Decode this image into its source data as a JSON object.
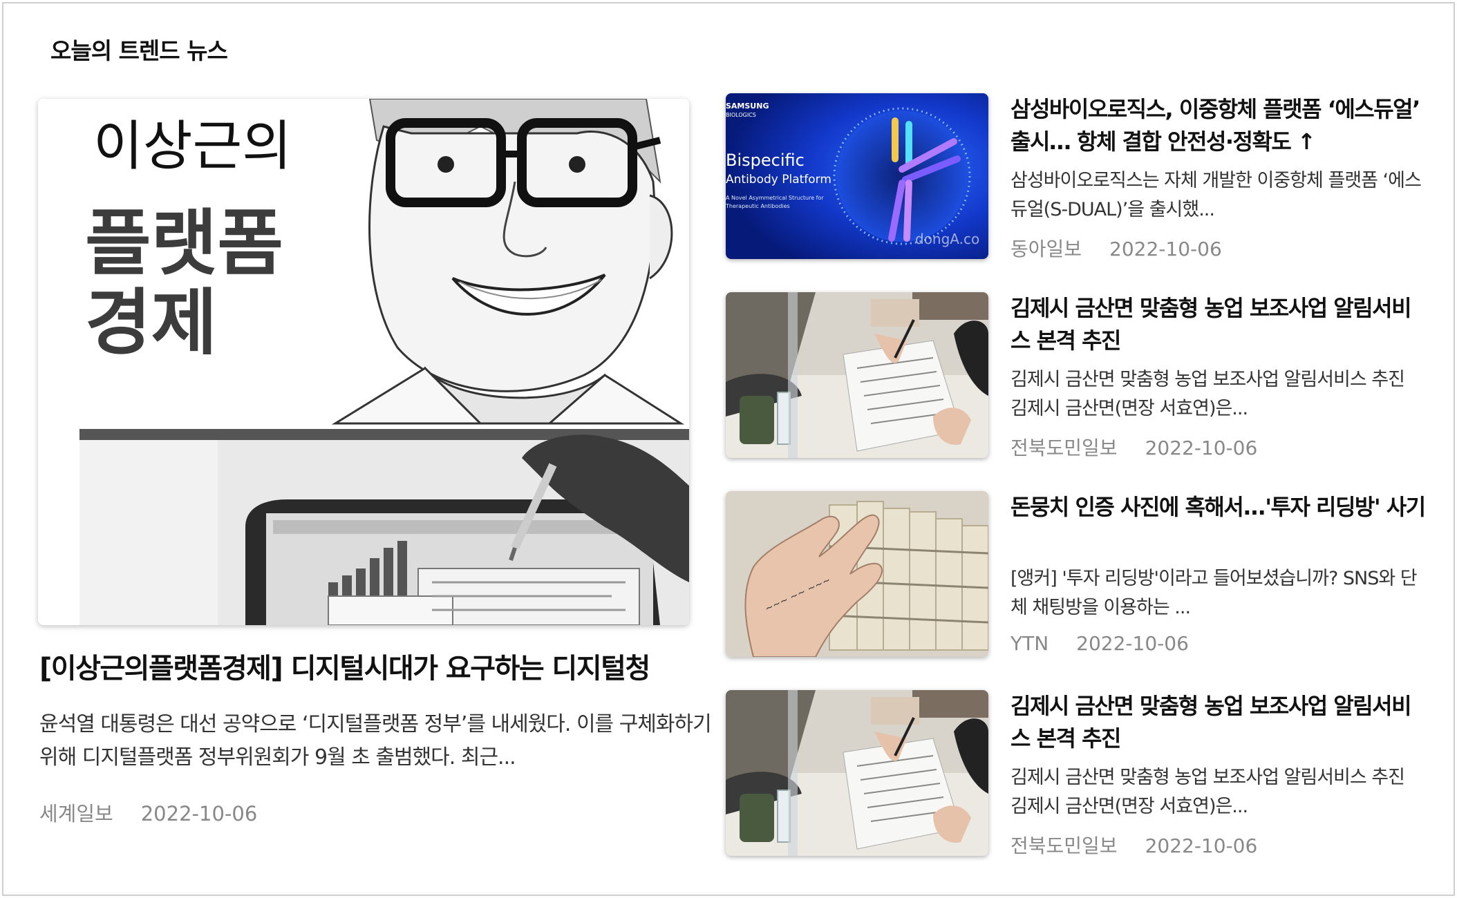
{
  "section": {
    "title": "오늘의 트렌드 뉴스"
  },
  "main_article": {
    "image_alt": "이상근의 플랫폼경제 칼럼 일러스트",
    "image_text_line1": "이상근의",
    "image_text_line2": "플랫폼",
    "image_text_line3": "경제",
    "headline": "[이상근의플랫폼경제] 디지털시대가 요구하는 디지털청",
    "summary": "윤석열 대통령은 대선 공약으로 ‘디지털플랫폼 정부’를 내세웠다. 이를 구체화하기 위해 디지털플랫폼 정부위원회가 9월 초 출범했다. 최근...",
    "source": "세계일보",
    "date": "2022-10-06"
  },
  "side_articles": [
    {
      "headline": "삼성바이오로직스, 이중항체 플랫폼 ‘에스듀얼’ 출시… 항체 결합 안전성·정확도 ↑",
      "summary": "삼성바이오로직스는 자체 개발한 이중항체 플랫폼 ‘에스듀얼(S-DUAL)’을 출시했...",
      "source": "동아일보",
      "date": "2022-10-06",
      "thumb_brand": "SAMSUNG",
      "thumb_sub": "BIOLOGICS",
      "thumb_title1": "Bispecific",
      "thumb_title2": "Antibody Platform",
      "thumb_caption1": "A Novel Asymmetrical Structure for",
      "thumb_caption2": "Therapeutic Antibodies",
      "thumb_watermark": "dongA.co"
    },
    {
      "headline": "김제시 금산면 맞춤형 농업 보조사업 알림서비스 본격 추진",
      "summary": "김제시 금산면 맞춤형 농업 보조사업 알림서비스 추진 김제시 금산면(면장 서효연)은...",
      "source": "전북도민일보",
      "date": "2022-10-06"
    },
    {
      "headline": "돈뭉치 인증 사진에 혹해서...'투자 리딩방' 사기",
      "summary": "[앵커] '투자 리딩방'이라고 들어보셨습니까? SNS와 단체 채팅방을 이용하는 ...",
      "source": "YTN",
      "date": "2022-10-06"
    },
    {
      "headline": "김제시 금산면 맞춤형 농업 보조사업 알림서비스 본격 추진",
      "summary": "김제시 금산면 맞춤형 농업 보조사업 알림서비스 추진 김제시 금산면(면장 서효연)은...",
      "source": "전북도민일보",
      "date": "2022-10-06"
    }
  ]
}
